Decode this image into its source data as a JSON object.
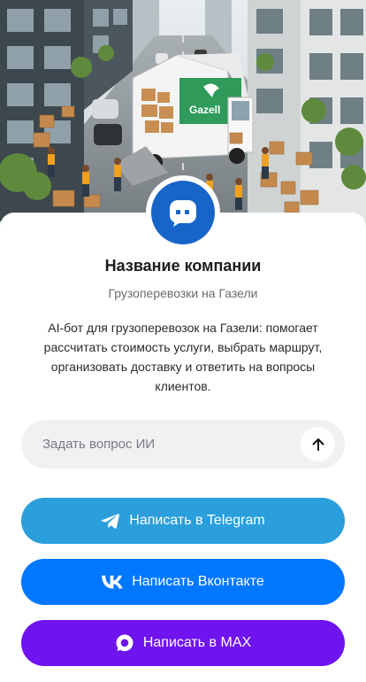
{
  "hero": {
    "image_name": "gazelle-cargo-street-illustration",
    "truck_logo_text": "Gazell"
  },
  "company": {
    "avatar_icon": "chat-bubble-icon",
    "name": "Название компании",
    "subtitle": "Грузоперевозки на Газели",
    "description": "AI-бот для грузоперевозок на Газели: помогает рассчитать стоимость услуги, выбрать маршрут, организовать доставку и ответить на вопросы клиентов."
  },
  "ask": {
    "placeholder": "Задать вопрос ИИ",
    "value": "",
    "send_icon": "arrow-up-icon"
  },
  "buttons": {
    "telegram": {
      "label": "Написать в Telegram",
      "icon": "telegram-icon",
      "color": "#2a9fdc"
    },
    "vk": {
      "label": "Написать Вконтакте",
      "icon": "vk-icon",
      "color": "#0077ff"
    },
    "max": {
      "label": "Написать в MAX",
      "icon": "max-icon",
      "color": "#6f14ef"
    }
  },
  "colors": {
    "avatar_bg": "#1865c9",
    "input_bg": "#f1f1f3"
  }
}
